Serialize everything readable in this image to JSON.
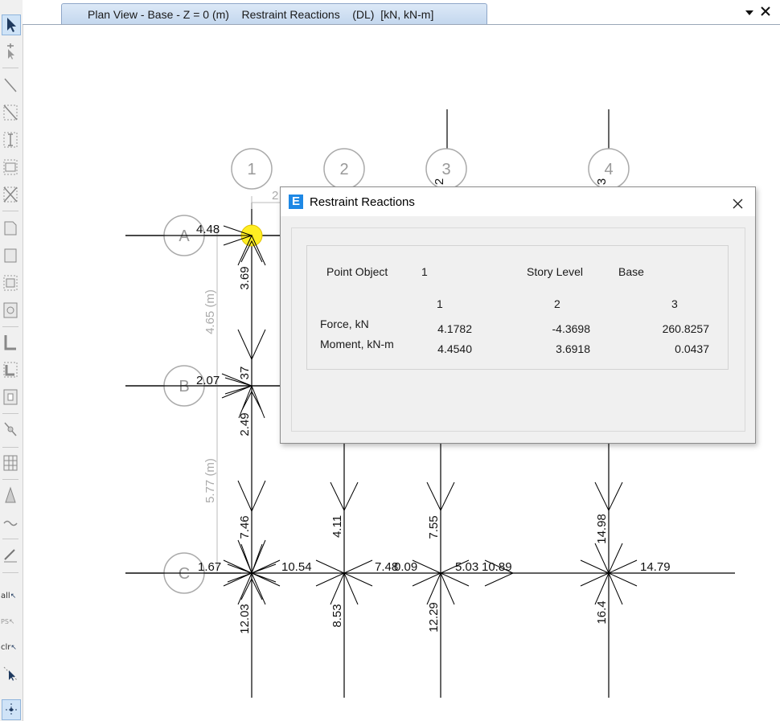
{
  "tab": {
    "title": "Plan View - Base - Z = 0 (m)    Restraint Reactions    (DL)  [kN, kN-m]"
  },
  "toolbar": {
    "all_label": "all",
    "ps_label": "PS",
    "clr_label": "clr"
  },
  "grid": {
    "columns": [
      "1",
      "2",
      "3",
      "4"
    ],
    "rows": [
      "A",
      "B",
      "C"
    ],
    "dims": {
      "ab": "4.65 (m)",
      "bc": "5.77 (m)",
      "top": "2"
    }
  },
  "reactions": {
    "a1_left": "4.48",
    "a1_down": "3.69",
    "b1_left": "2.07",
    "b1_up": "37",
    "b1_down": "2.49",
    "c1_up": "7.46",
    "c1_left": "1.67",
    "c1_right": "10.54",
    "c1_down": "12.03",
    "c2_up": "4.11",
    "c2_right": "7.48",
    "c2_down": "8.53",
    "c3_left": "0.09",
    "c3_up": "7.55",
    "c3_right": "5.03",
    "c3_right2": "10.89",
    "c3_down": "12.29",
    "c4_up": "14.98",
    "c4_right": "14.79",
    "c4_down": "16.4",
    "a3_side": "2",
    "a4_side": "3"
  },
  "dialog": {
    "title": "Restraint Reactions",
    "point_object_label": "Point Object",
    "point_object_value": "1",
    "story_level_label": "Story Level",
    "story_level_value": "Base",
    "col_headers": [
      "1",
      "2",
      "3"
    ],
    "force_label": "Force, kN",
    "moment_label": "Moment, kN-m",
    "force_values": [
      "4.1782",
      "-4.3698",
      "260.8257"
    ],
    "moment_values": [
      "4.4540",
      "3.6918",
      "0.0437"
    ]
  }
}
